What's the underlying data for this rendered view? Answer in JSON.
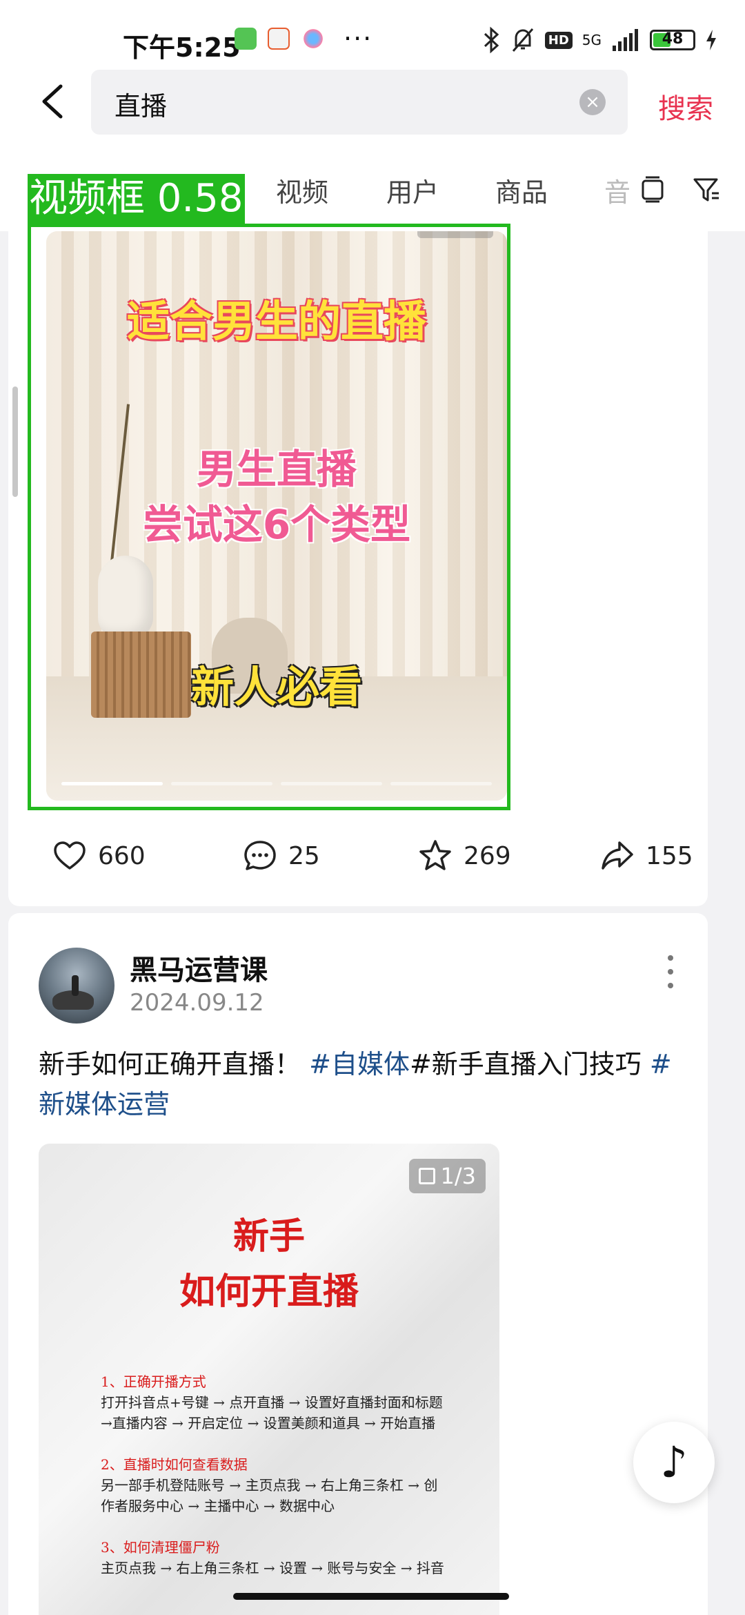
{
  "status_bar": {
    "time": "下午5:25",
    "more": "···",
    "network": "5G",
    "hd": "HD",
    "battery": "48",
    "battery_level": 0.48
  },
  "search": {
    "query": "直播",
    "submit_label": "搜索"
  },
  "tabs": {
    "items": [
      "视频",
      "用户",
      "商品"
    ],
    "overflow_label": "音"
  },
  "detection": {
    "label": "视频框 0.58"
  },
  "post1": {
    "overlay_title": "适合男生的直播",
    "overlay_sub_1": "男生直播",
    "overlay_sub_2": "尝试这6个类型",
    "overlay_tag": "新人必看",
    "likes": "660",
    "comments": "25",
    "favorites": "269",
    "shares": "155"
  },
  "post2": {
    "author": "黑马运营课",
    "date": "2024.09.12",
    "text_prefix": "新手如何正确开直播！",
    "hashtag_1": "#自媒体",
    "hashtag_2": "#新手直播入门技巧",
    "hashtag_3": "#新媒体运营",
    "image_counter": "1/3",
    "image_title_1": "新手",
    "image_title_2": "如何开直播",
    "sections": [
      {
        "title": "1、正确开播方式",
        "line1": "打开抖音点+号键 → 点开直播 → 设置好直播封面和标题",
        "line2": "→直播内容 → 开启定位 → 设置美颜和道具 → 开始直播"
      },
      {
        "title": "2、直播时如何查看数据",
        "line1": "另一部手机登陆账号 → 主页点我 → 右上角三条杠 → 创",
        "line2": "作者服务中心 → 主播中心 → 数据中心"
      },
      {
        "title": "3、如何清理僵尸粉",
        "line1": "主页点我 → 右上角三条杠 → 设置 → 账号与安全 → 抖音",
        "line2": ""
      }
    ]
  },
  "fab_glyph": "♪",
  "colors": {
    "accent": "#e8324f",
    "hashtag": "#1e4f8a",
    "detection": "#23b91f"
  }
}
